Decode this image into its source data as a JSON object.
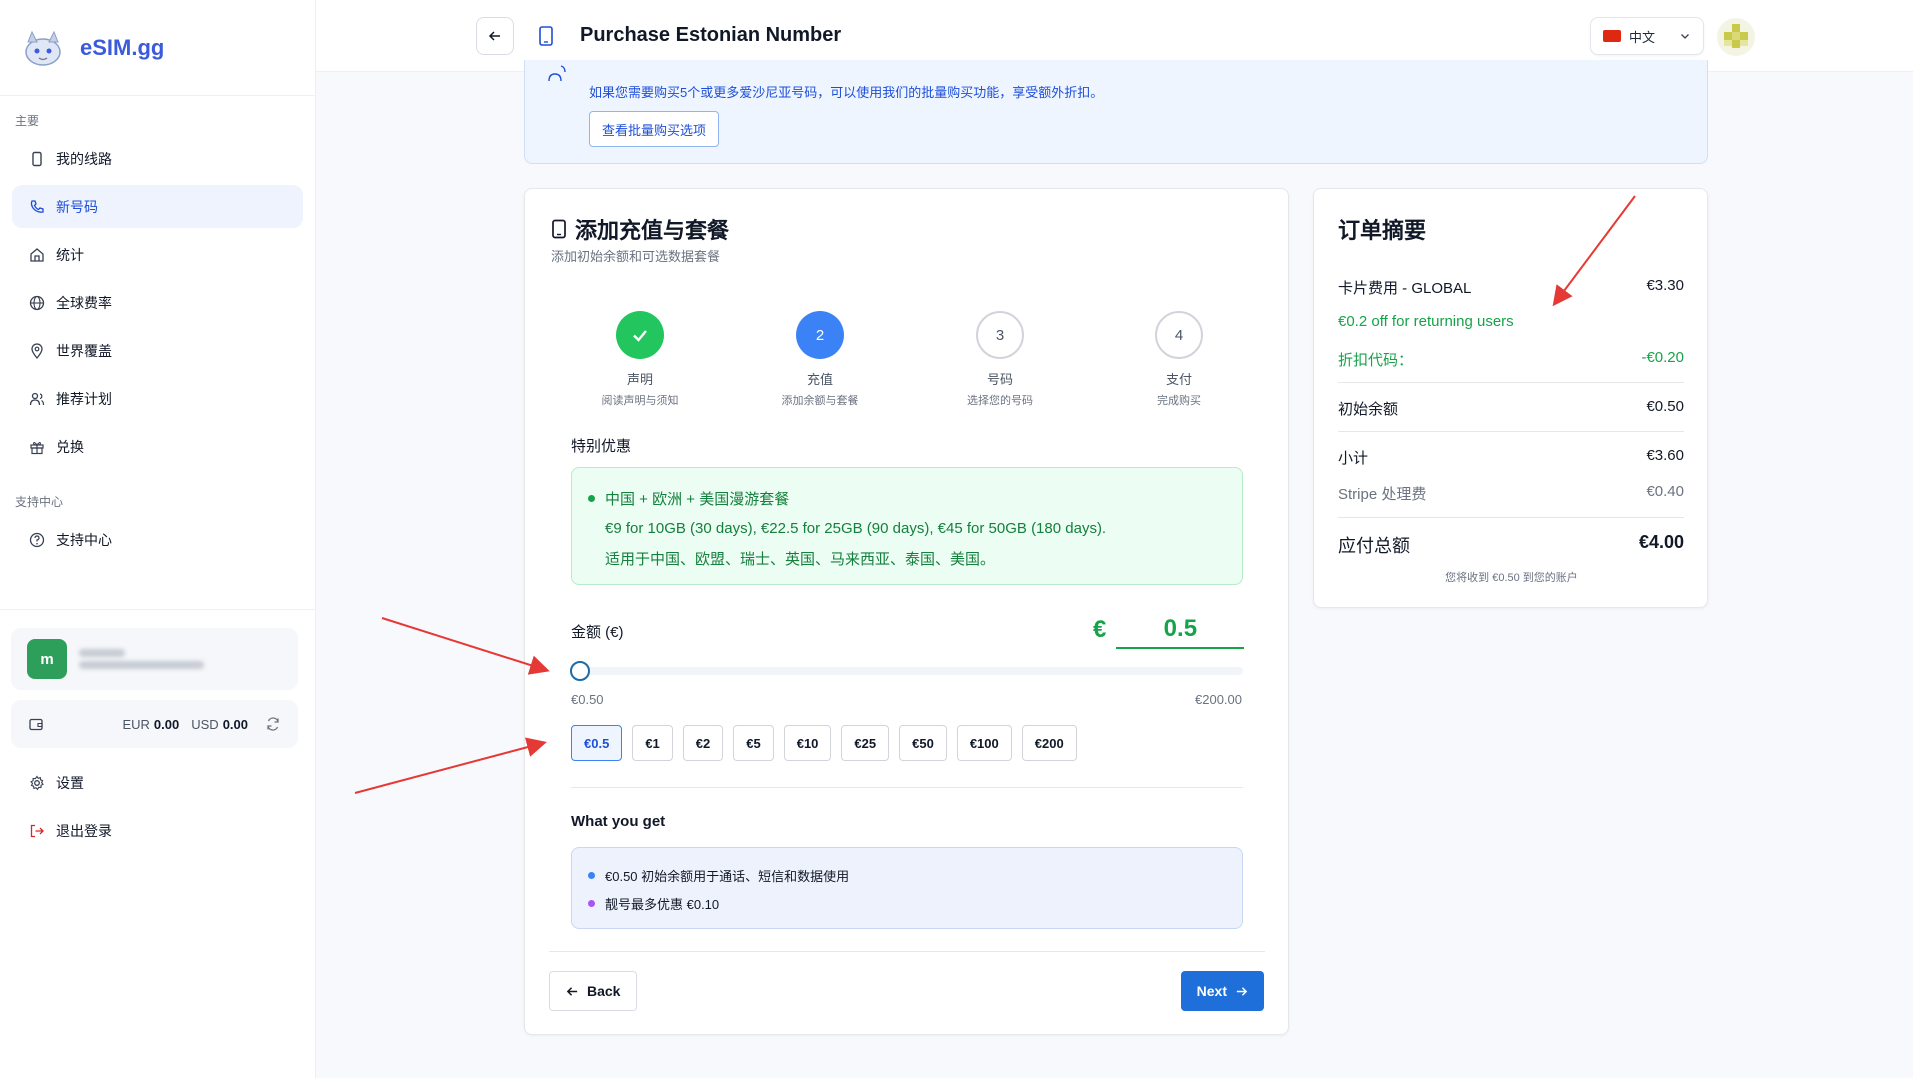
{
  "sidebar": {
    "brand_name": "eSIM.gg",
    "main_section": "主要",
    "items": [
      {
        "label": "我的线路"
      },
      {
        "label": "新号码"
      },
      {
        "label": "统计"
      },
      {
        "label": "全球费率"
      },
      {
        "label": "世界覆盖"
      },
      {
        "label": "推荐计划"
      },
      {
        "label": "兑换"
      }
    ],
    "support_section": "支持中心",
    "support_item": "支持中心",
    "user_initial": "m",
    "wallet": {
      "eur_label": "EUR",
      "eur_value": "0.00",
      "usd_label": "USD",
      "usd_value": "0.00"
    },
    "settings": "设置",
    "logout": "退出登录"
  },
  "header": {
    "title": "Purchase Estonian Number",
    "language": "中文"
  },
  "banner": {
    "text": "如果您需要购买5个或更多爱沙尼亚号码，可以使用我们的批量购买功能，享受额外折扣。",
    "button": "查看批量购买选项"
  },
  "card": {
    "title": "添加充值与套餐",
    "subtitle": "添加初始余额和可选数据套餐",
    "steps": [
      {
        "number": "✓",
        "name": "声明",
        "desc": "阅读声明与须知",
        "state": "done"
      },
      {
        "number": "2",
        "name": "充值",
        "desc": "添加余额与套餐",
        "state": "current"
      },
      {
        "number": "3",
        "name": "号码",
        "desc": "选择您的号码",
        "state": "todo"
      },
      {
        "number": "4",
        "name": "支付",
        "desc": "完成购买",
        "state": "todo"
      }
    ],
    "offer_label": "特别优惠",
    "offer": {
      "title": "中国 + 欧洲 + 美国漫游套餐",
      "line1": "€9 for 10GB (30 days), €22.5 for 25GB (90 days), €45 for 50GB (180 days).",
      "line2": "适用于中国、欧盟、瑞士、英国、马来西亚、泰国、美国。"
    },
    "amount_label": "金额 (€)",
    "currency_symbol": "€",
    "amount_value": "0.5",
    "slider": {
      "min_label": "€0.50",
      "max_label": "€200.00",
      "value": 0.5,
      "min": 0.5,
      "max": 200
    },
    "quick_amounts": [
      "€0.5",
      "€1",
      "€2",
      "€5",
      "€10",
      "€25",
      "€50",
      "€100",
      "€200"
    ],
    "selected_amount": "€0.5",
    "what_you_get_label": "What you get",
    "get_items": [
      {
        "text": "€0.50 初始余额用于通话、短信和数据使用",
        "color": "#3b82f6"
      },
      {
        "text": "靓号最多优惠 €0.10",
        "color": "#a855f7"
      }
    ],
    "back_label": "Back",
    "next_label": "Next"
  },
  "summary": {
    "title": "订单摘要",
    "card_fee_label": "卡片费用 - GLOBAL",
    "card_fee_value": "€3.30",
    "returning_note": "€0.2 off for returning users",
    "discount_label": "折扣代码：",
    "discount_value": "-€0.20",
    "initial_balance_label": "初始余额",
    "initial_balance_value": "€0.50",
    "subtotal_label": "小计",
    "subtotal_value": "€3.60",
    "stripe_fee_label": "Stripe 处理费",
    "stripe_fee_value": "€0.40",
    "total_label": "应付总额",
    "total_value": "€4.00",
    "note": "您将收到 €0.50 到您的账户"
  },
  "colors": {
    "accent": "#1e6fd9",
    "green": "#16a34a",
    "arrow": "#e53935"
  }
}
